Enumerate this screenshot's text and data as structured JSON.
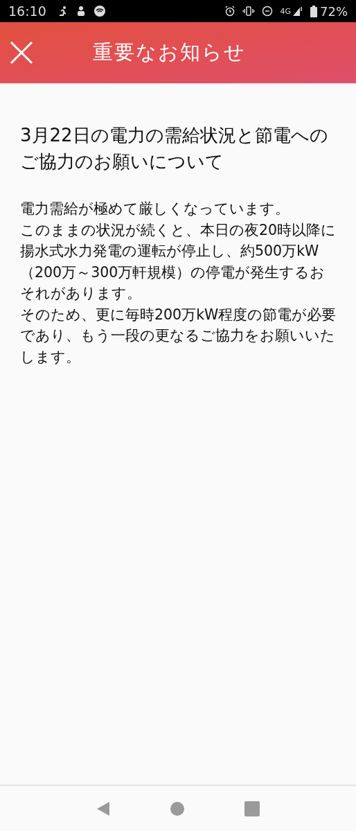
{
  "status_bar": {
    "time": "16:10",
    "network": "4G",
    "battery": "72%"
  },
  "header": {
    "title": "重要なお知らせ"
  },
  "notice": {
    "title": "3月22日の電力の需給状況と節電へのご協力のお願いについて",
    "paragraphs": [
      "電力需給が極めて厳しくなっています。",
      "このままの状況が続くと、本日の夜20時以降に揚水式水力発電の運転が停止し、約500万kW（200万～300万軒規模）の停電が発生するおそれがあります。",
      "そのため、更に毎時200万kW程度の節電が必要であり、もう一段の更なるご協力をお願いいたします。"
    ]
  }
}
